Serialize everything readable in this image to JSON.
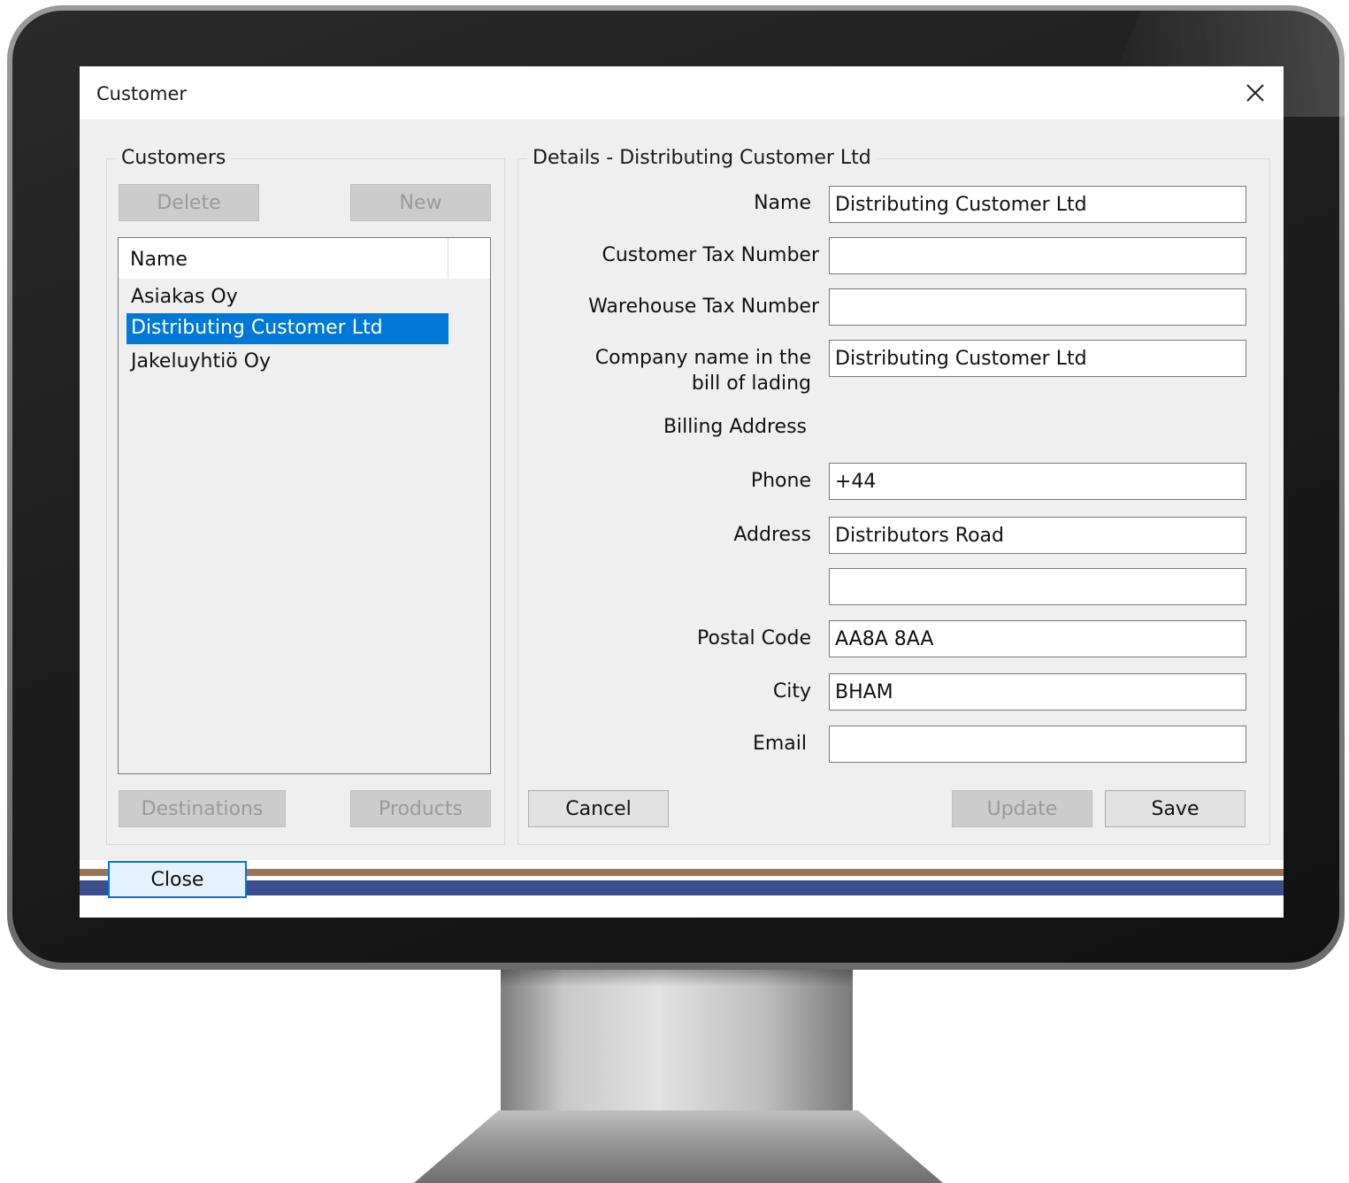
{
  "window": {
    "title": "Customer"
  },
  "customers_group": {
    "legend": "Customers",
    "delete_label": "Delete",
    "new_label": "New",
    "list_header": "Name",
    "items": [
      {
        "label": "Asiakas Oy",
        "selected": false
      },
      {
        "label": "Distributing Customer Ltd",
        "selected": true
      },
      {
        "label": "Jakeluyhtiö Oy",
        "selected": false
      }
    ],
    "destinations_label": "Destinations",
    "products_label": "Products"
  },
  "details_group": {
    "legend": "Details - Distributing Customer Ltd",
    "fields": {
      "name": {
        "label": "Name",
        "value": "Distributing Customer Ltd"
      },
      "customer_tax_number": {
        "label": "Customer Tax Number",
        "value": ""
      },
      "warehouse_tax_number": {
        "label": "Warehouse Tax Number",
        "value": ""
      },
      "company_name_bol": {
        "label_line1": "Company name in the",
        "label_line2": "bill of lading",
        "value": "Distributing Customer Ltd"
      },
      "billing_address_heading": "Billing Address",
      "phone": {
        "label": "Phone",
        "value": "+44"
      },
      "address": {
        "label": "Address",
        "value": "Distributors Road",
        "value2": ""
      },
      "postal_code": {
        "label": "Postal Code",
        "value": "AA8A 8AA"
      },
      "city": {
        "label": "City",
        "value": "BHAM"
      },
      "email": {
        "label": "Email",
        "value": ""
      }
    },
    "cancel_label": "Cancel",
    "update_label": "Update",
    "save_label": "Save"
  },
  "footer": {
    "close_label": "Close"
  },
  "colors": {
    "selection": "#0078d7",
    "stripe_brown": "#9b7451",
    "stripe_blue": "#3a4f8c"
  },
  "icons": {
    "close": "close-icon"
  }
}
